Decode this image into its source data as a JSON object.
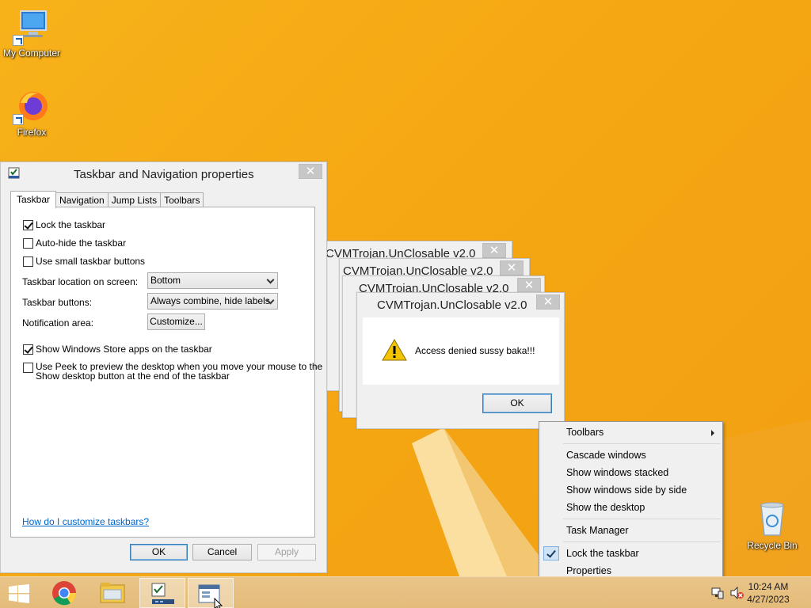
{
  "desktop": {
    "icons": [
      {
        "label": "My Computer"
      },
      {
        "label": "Firefox"
      },
      {
        "label": "Recycle Bin"
      }
    ]
  },
  "taskbar_properties": {
    "title": "Taskbar and Navigation properties",
    "tabs": [
      "Taskbar",
      "Navigation",
      "Jump Lists",
      "Toolbars"
    ],
    "active_tab": "Taskbar",
    "options": {
      "lock_taskbar": {
        "label": "Lock the taskbar",
        "checked": true
      },
      "auto_hide": {
        "label": "Auto-hide the taskbar",
        "checked": false
      },
      "small_buttons": {
        "label": "Use small taskbar buttons",
        "checked": false
      },
      "store_apps": {
        "label": "Show Windows Store apps on the taskbar",
        "checked": true
      },
      "peek_line1": "Use Peek to preview the desktop when you move your mouse to the",
      "peek_line2": "Show desktop button at the end of the taskbar"
    },
    "location_label": "Taskbar location on screen:",
    "location_value": "Bottom",
    "buttons_label": "Taskbar buttons:",
    "buttons_value": "Always combine, hide labels",
    "notification_label": "Notification area:",
    "customize_label": "Customize...",
    "help_link": "How do I customize taskbars?",
    "ok_label": "OK",
    "cancel_label": "Cancel",
    "apply_label": "Apply"
  },
  "trojan_windows": {
    "title": "CVMTrojan.UnClosable v2.0",
    "message": "Access denied sussy baka!!!",
    "ok_label": "OK"
  },
  "context_menu": {
    "toolbars": "Toolbars",
    "cascade": "Cascade windows",
    "stacked": "Show windows stacked",
    "side_by_side": "Show windows side by side",
    "show_desktop": "Show the desktop",
    "task_manager": "Task Manager",
    "lock_taskbar": "Lock the taskbar",
    "properties": "Properties"
  },
  "tray": {
    "time": "10:24 AM",
    "date": "4/27/2023"
  },
  "colors": {
    "wallpaper": "#f5a713",
    "taskbar": "#e6bf80",
    "link": "#0066cc"
  }
}
